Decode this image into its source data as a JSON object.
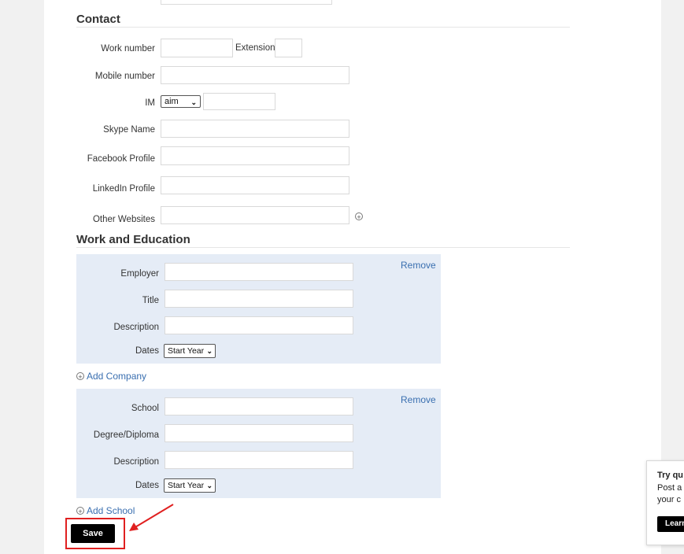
{
  "contact": {
    "title": "Contact",
    "work_number_label": "Work number",
    "extension_label": "Extension",
    "mobile_label": "Mobile number",
    "im_label": "IM",
    "im_selected": "aim",
    "skype_label": "Skype Name",
    "facebook_label": "Facebook Profile",
    "linkedin_label": "LinkedIn Profile",
    "other_websites_label": "Other Websites"
  },
  "work_education": {
    "title": "Work and Education",
    "company": {
      "remove_label": "Remove",
      "employer_label": "Employer",
      "title_label": "Title",
      "description_label": "Description",
      "dates_label": "Dates",
      "start_year": "Start Year"
    },
    "add_company_label": "Add Company",
    "school": {
      "remove_label": "Remove",
      "school_label": "School",
      "degree_label": "Degree/Diploma",
      "description_label": "Description",
      "dates_label": "Dates",
      "start_year": "Start Year"
    },
    "add_school_label": "Add School"
  },
  "save_label": "Save",
  "popup": {
    "line1": "Try qu",
    "line2": "Post a",
    "line3": "your c",
    "button": "Learn"
  },
  "colors": {
    "panel_bg": "#e5ecf6",
    "link": "#3a6fb0",
    "highlight": "#e02020"
  }
}
